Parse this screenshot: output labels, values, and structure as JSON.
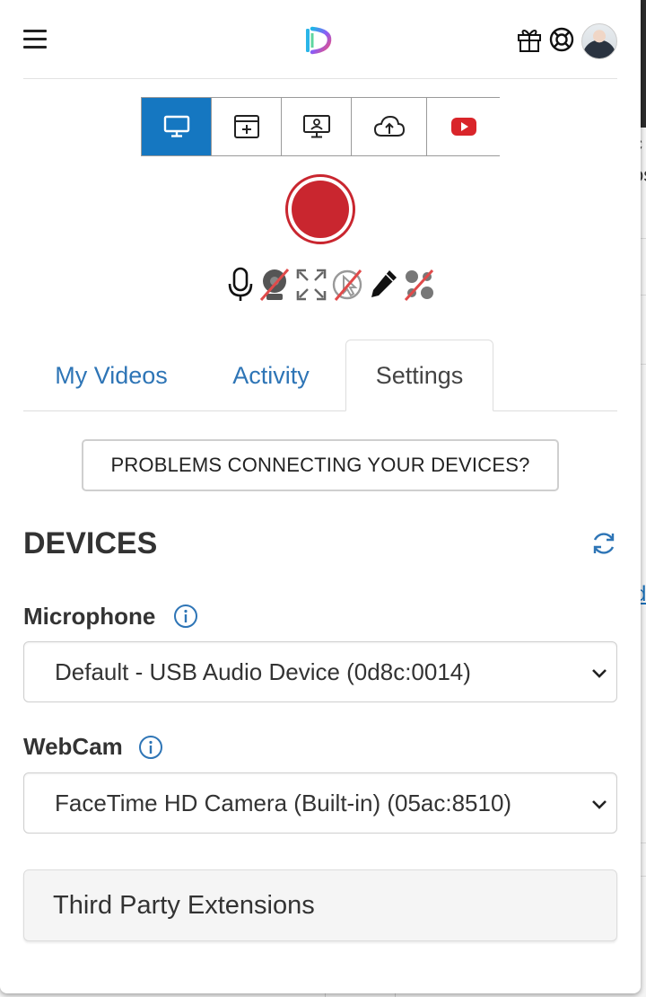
{
  "header": {
    "menu_icon": "hamburger-menu-icon",
    "logo_icon": "dubb-logo-icon",
    "gift_icon": "gift-icon",
    "help_icon": "lifebuoy-icon",
    "avatar": "user-avatar"
  },
  "sources": [
    {
      "icon": "monitor-icon",
      "active": true
    },
    {
      "icon": "add-window-icon",
      "active": false
    },
    {
      "icon": "screen-with-person-icon",
      "active": false
    },
    {
      "icon": "cloud-upload-icon",
      "active": false
    },
    {
      "icon": "youtube-icon",
      "active": false
    }
  ],
  "record": {
    "icon": "record-icon"
  },
  "options": [
    {
      "icon": "microphone-icon",
      "enabled": true
    },
    {
      "icon": "webcam-off-icon",
      "enabled": false
    },
    {
      "icon": "fullscreen-icon",
      "enabled": true
    },
    {
      "icon": "cursor-highlight-off-icon",
      "enabled": false
    },
    {
      "icon": "pencil-icon",
      "enabled": true
    },
    {
      "icon": "blur-off-icon",
      "enabled": false
    }
  ],
  "tabs": [
    {
      "label": "My Videos",
      "active": false
    },
    {
      "label": "Activity",
      "active": false
    },
    {
      "label": "Settings",
      "active": true
    }
  ],
  "settings": {
    "problems_label": "PROBLEMS CONNECTING YOUR DEVICES?",
    "devices_title": "DEVICES",
    "microphone": {
      "label": "Microphone",
      "selected": "Default - USB Audio Device (0d8c:0014)"
    },
    "webcam": {
      "label": "WebCam",
      "selected": "FaceTime HD Camera (Built-in) (05ac:8510)"
    },
    "third_party_label": "Third Party Extensions"
  },
  "background": {
    "text_1": "c",
    "text_2": "os",
    "link_text": "d"
  },
  "colors": {
    "accent": "#1577c1",
    "record": "#c9262f",
    "link": "#2e75b6",
    "youtube": "#d9252a"
  }
}
